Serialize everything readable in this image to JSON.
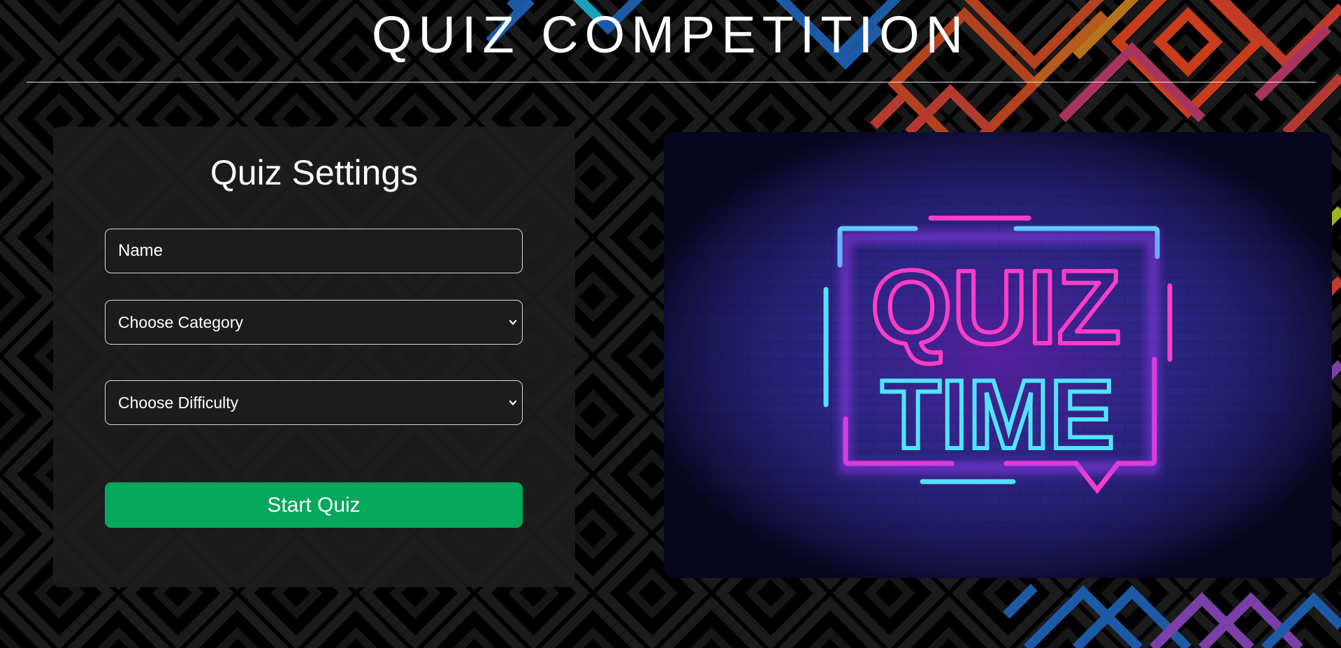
{
  "header": {
    "title": "QUIZ COMPETITION"
  },
  "settings": {
    "title": "Quiz Settings",
    "name_placeholder": "Name",
    "category_selected": "Choose Category",
    "difficulty_selected": "Choose Difficulty",
    "start_label": "Start Quiz"
  },
  "hero": {
    "top_word": "QUIZ",
    "bottom_word": "TIME"
  },
  "colors": {
    "accent": "#05a85a",
    "neon_pink": "#ff3ec8",
    "neon_cyan": "#52e4ff",
    "card_bg": "#1e1e1e"
  },
  "icons": {
    "dropdown": "chevron-down-icon"
  }
}
